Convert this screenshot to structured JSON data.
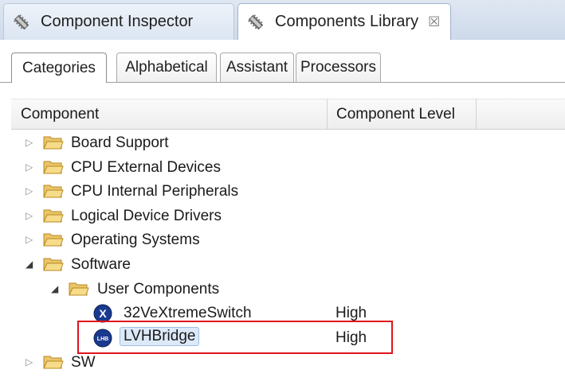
{
  "view_tabs": [
    {
      "label": "Component Inspector",
      "icon": "gear-icon"
    },
    {
      "label": "Components Library",
      "icon": "gear-icon",
      "close": "☒"
    }
  ],
  "sub_tabs": [
    "Categories",
    "Alphabetical",
    "Assistant",
    "Processors"
  ],
  "columns": {
    "component": "Component",
    "level": "Component Level"
  },
  "tree": {
    "board_support": "Board Support",
    "cpu_external": "CPU External Devices",
    "cpu_internal": "CPU Internal Peripherals",
    "logical_drivers": "Logical Device Drivers",
    "operating_systems": "Operating Systems",
    "software": "Software",
    "user_components": "User Components",
    "switch": {
      "label": "32VeXtremeSwitch",
      "level": "High",
      "icon_text": "X"
    },
    "bridge": {
      "label": "LVHBridge",
      "level": "High",
      "icon_text": "LHB"
    },
    "sw": "SW"
  },
  "colors": {
    "highlight": "#e0141b",
    "selection": "#dce9f8"
  }
}
